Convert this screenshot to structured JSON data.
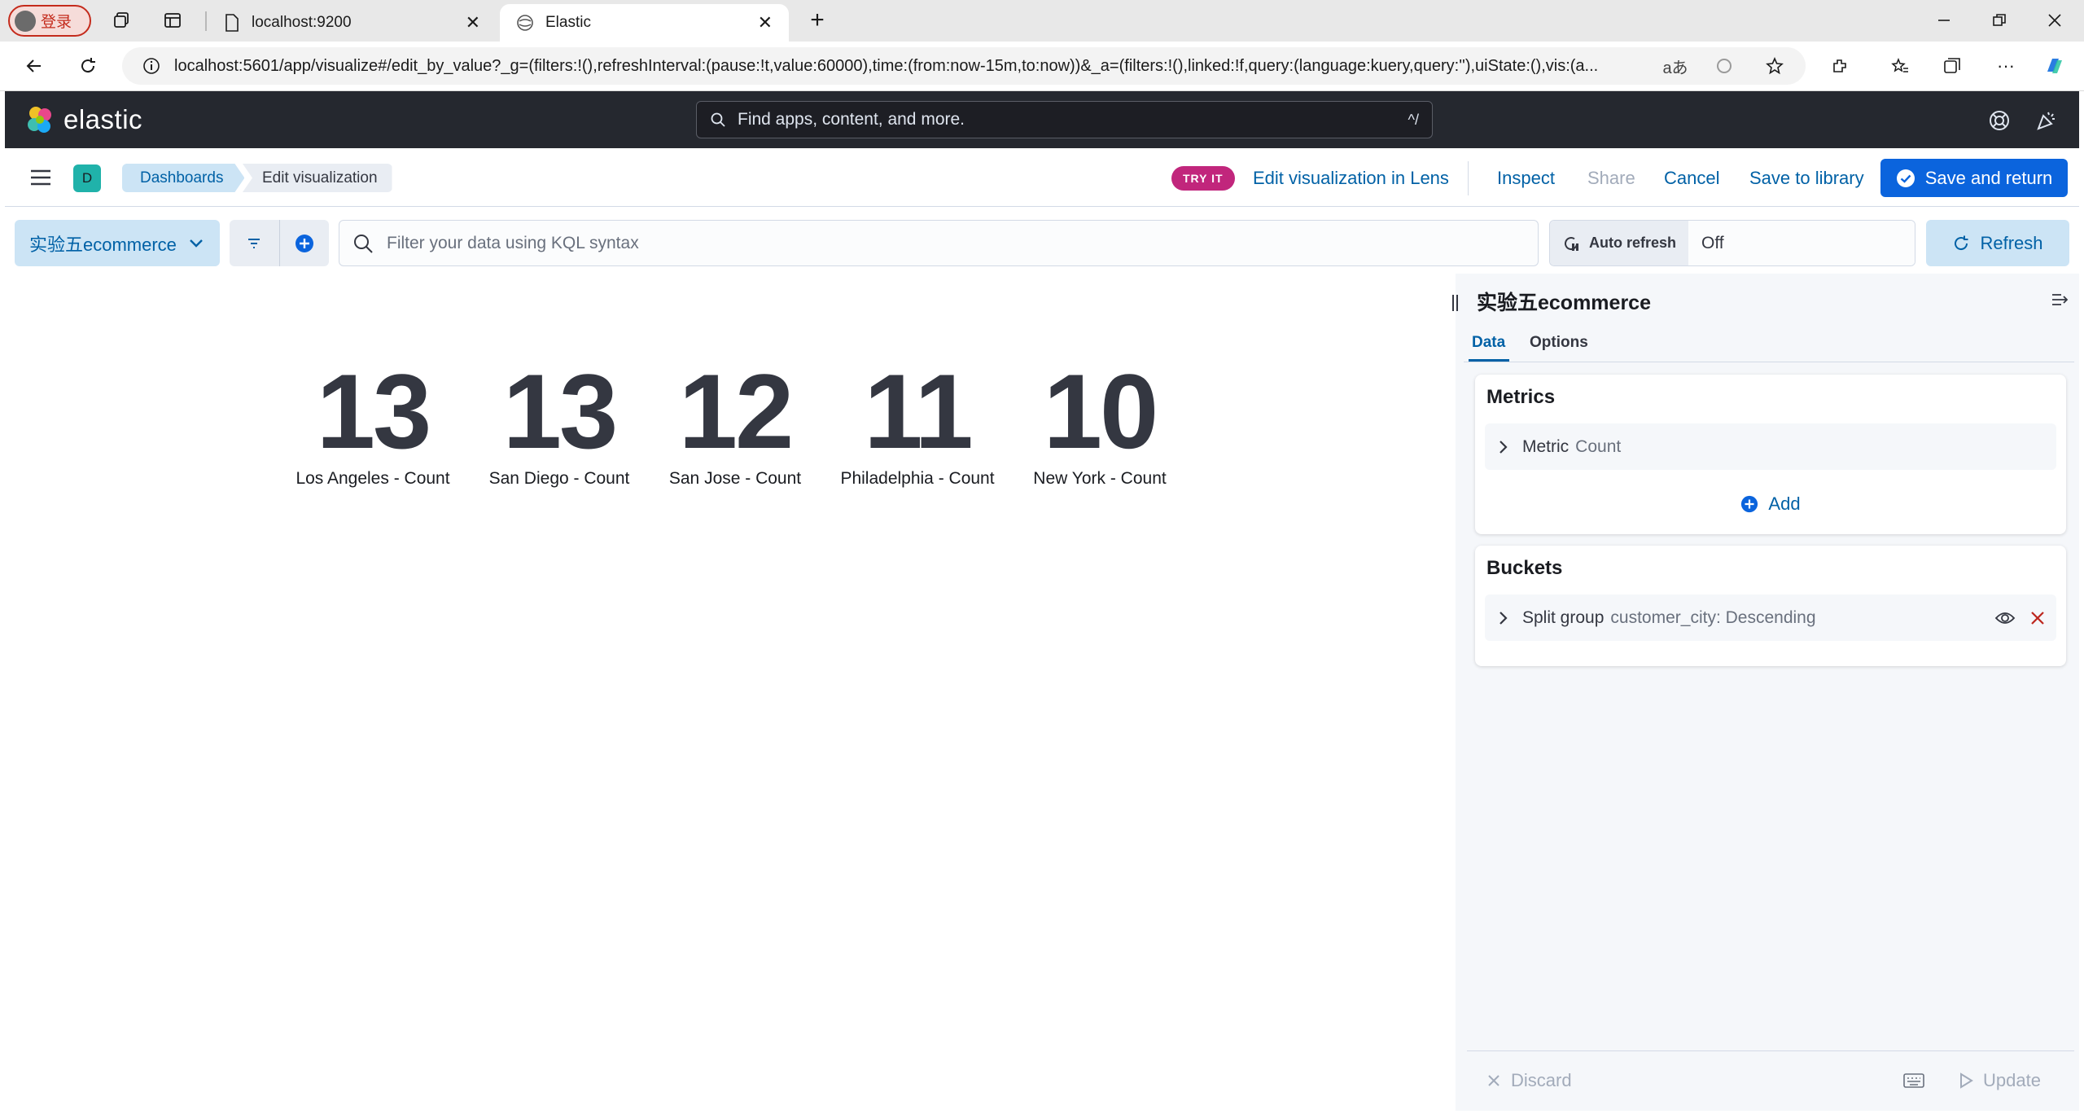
{
  "browser": {
    "login_label": "登录",
    "tabs": [
      {
        "title": "localhost:9200"
      },
      {
        "title": "Elastic"
      }
    ],
    "url": "localhost:5601/app/visualize#/edit_by_value?_g=(filters:!(),refreshInterval:(pause:!t,value:60000),time:(from:now-15m,to:now))&_a=(filters:!(),linked:!f,query:(language:kuery,query:''),uiState:(),vis:(a..."
  },
  "kibana": {
    "logo_text": "elastic",
    "search_placeholder": "Find apps, content, and more.",
    "search_shortcut": "^/",
    "space_initial": "D",
    "breadcrumbs": [
      "Dashboards",
      "Edit visualization"
    ],
    "try_it_badge": "TRY IT",
    "lens_link": "Edit visualization in Lens",
    "inspect": "Inspect",
    "share": "Share",
    "cancel": "Cancel",
    "save_to_library": "Save to library",
    "save_and_return": "Save and return"
  },
  "query_bar": {
    "data_view": "实验五ecommerce",
    "kql_placeholder": "Filter your data using KQL syntax",
    "auto_refresh_label": "Auto refresh",
    "auto_refresh_value": "Off",
    "refresh": "Refresh"
  },
  "metrics": [
    {
      "value": "13",
      "label": "Los Angeles - Count"
    },
    {
      "value": "13",
      "label": "San Diego - Count"
    },
    {
      "value": "12",
      "label": "San Jose - Count"
    },
    {
      "value": "11",
      "label": "Philadelphia - Count"
    },
    {
      "value": "10",
      "label": "New York - Count"
    }
  ],
  "sidebar": {
    "title": "实验五ecommerce",
    "tabs": [
      "Data",
      "Options"
    ],
    "metrics_panel": {
      "title": "Metrics",
      "row_type": "Metric",
      "row_desc": "Count",
      "add": "Add"
    },
    "buckets_panel": {
      "title": "Buckets",
      "row_type": "Split group",
      "row_desc": "customer_city: Descending"
    },
    "discard": "Discard",
    "update": "Update"
  }
}
